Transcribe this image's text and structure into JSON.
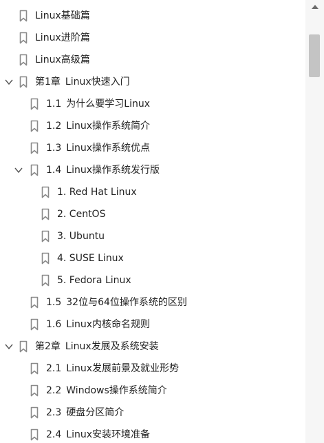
{
  "bookmarks": [
    {
      "num": "",
      "title": "Linux基础篇",
      "level": 0,
      "toggle": "none",
      "icon": "bookmark-icon"
    },
    {
      "num": "",
      "title": "Linux进阶篇",
      "level": 0,
      "toggle": "none",
      "icon": "bookmark-icon"
    },
    {
      "num": "",
      "title": "Linux高级篇",
      "level": 0,
      "toggle": "none",
      "icon": "bookmark-icon"
    },
    {
      "num": "第1章",
      "title": "Linux快速入门",
      "level": 0,
      "toggle": "expanded",
      "icon": "bookmark-icon"
    },
    {
      "num": "1.1",
      "title": "为什么要学习Linux",
      "level": 1,
      "toggle": "none",
      "icon": "bookmark-icon"
    },
    {
      "num": "1.2",
      "title": "Linux操作系统简介",
      "level": 1,
      "toggle": "none",
      "icon": "bookmark-icon"
    },
    {
      "num": "1.3",
      "title": "Linux操作系统优点",
      "level": 1,
      "toggle": "none",
      "icon": "bookmark-icon"
    },
    {
      "num": "1.4",
      "title": "Linux操作系统发行版",
      "level": 1,
      "toggle": "expanded",
      "icon": "bookmark-icon"
    },
    {
      "num": "",
      "title": "1. Red Hat Linux",
      "level": 2,
      "toggle": "none",
      "icon": "bookmark-icon"
    },
    {
      "num": "",
      "title": "2. CentOS",
      "level": 2,
      "toggle": "none",
      "icon": "bookmark-icon"
    },
    {
      "num": "",
      "title": "3. Ubuntu",
      "level": 2,
      "toggle": "none",
      "icon": "bookmark-icon"
    },
    {
      "num": "",
      "title": "4. SUSE Linux",
      "level": 2,
      "toggle": "none",
      "icon": "bookmark-icon"
    },
    {
      "num": "",
      "title": "5. Fedora Linux",
      "level": 2,
      "toggle": "none",
      "icon": "bookmark-icon"
    },
    {
      "num": "1.5",
      "title": "32位与64位操作系统的区别",
      "level": 1,
      "toggle": "none",
      "icon": "bookmark-icon"
    },
    {
      "num": "1.6",
      "title": "Linux内核命名规则",
      "level": 1,
      "toggle": "none",
      "icon": "bookmark-icon"
    },
    {
      "num": "第2章",
      "title": "Linux发展及系统安装",
      "level": 0,
      "toggle": "expanded",
      "icon": "bookmark-icon"
    },
    {
      "num": "2.1",
      "title": "Linux发展前景及就业形势",
      "level": 1,
      "toggle": "none",
      "icon": "bookmark-icon"
    },
    {
      "num": "2.2",
      "title": "Windows操作系统简介",
      "level": 1,
      "toggle": "none",
      "icon": "bookmark-icon"
    },
    {
      "num": "2.3",
      "title": "硬盘分区简介",
      "level": 1,
      "toggle": "none",
      "icon": "bookmark-icon"
    },
    {
      "num": "2.4",
      "title": "Linux安装环境准备",
      "level": 1,
      "toggle": "none",
      "icon": "bookmark-icon"
    }
  ],
  "scrollbar": {
    "up_icon": "scroll-up-arrow-icon",
    "position_fraction": 0.04,
    "visible_fraction": 0.1
  },
  "colors": {
    "icon_stroke": "#8a8a8a",
    "text": "#222222",
    "toggle": "#555555",
    "scroll_thumb": "#c4c4c4",
    "scroll_track": "#f6f6f6"
  }
}
